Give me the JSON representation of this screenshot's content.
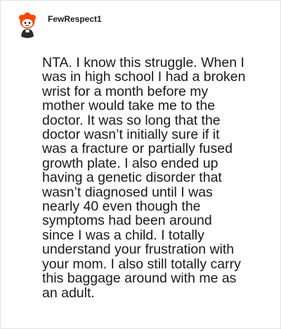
{
  "comment": {
    "username": "FewRespect1",
    "avatar_icon": "reddit-snoo-avatar-icon",
    "accent_color": "#ff4500",
    "body": "NTA. I know this struggle. When I\nwas in high school I had a broken\nwrist for a month before my\nmother would take me to the\ndoctor. It was so long that the\ndoctor wasn’t initially sure if it\nwas a fracture or partially fused\ngrowth plate. I also ended up\nhaving a genetic disorder that\nwasn’t diagnosed until I was\nnearly 40 even though the\nsymptoms had been around\nsince I was a child. I totally\nunderstand your frustration with\nyour mom. I also still totally carry\nthis baggage around with me as\nan adult."
  }
}
